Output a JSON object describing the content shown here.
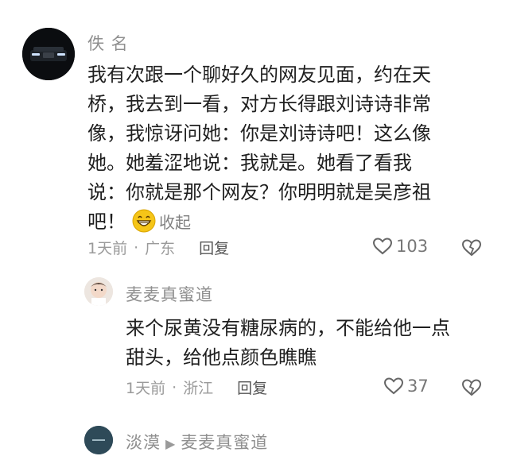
{
  "comment": {
    "author": "佚 名",
    "lines": [
      "我有次跟一个聊好久的网友见面，约在天",
      "桥，我去到一看，对方长得跟刘诗诗非常",
      "像，我惊讶问她：你是刘诗诗吧！这么像",
      "她。她羞涩地说：我就是。她看了看我",
      "说：你就是那个网友？你明明就是吴彦祖"
    ],
    "last_line": "吧！",
    "collapse_label": "收起",
    "time": "1天前",
    "location": "广东",
    "reply_label": "回复",
    "likes": "103"
  },
  "reply1": {
    "author": "麦麦真蜜道",
    "lines": [
      "来个尿黄没有糖尿病的，不能给他一点",
      "甜头，给他点颜色瞧瞧"
    ],
    "time": "1天前",
    "location": "浙江",
    "reply_label": "回复",
    "likes": "37"
  },
  "reply2": {
    "author": "淡漠",
    "target": "麦麦真蜜道"
  },
  "icons": {
    "like": "heart-outline-icon",
    "dislike": "broken-heart-icon",
    "emoji": "grinning-face-icon"
  },
  "colors": {
    "meta_text": "#9a9a9a",
    "emoji_yellow": "#f5c518"
  }
}
